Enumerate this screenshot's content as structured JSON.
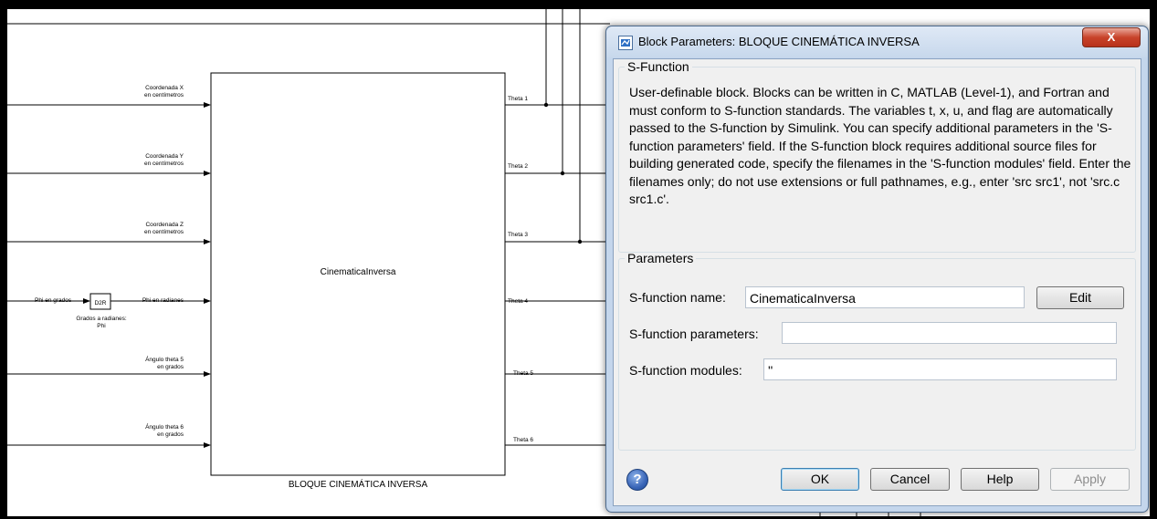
{
  "diagram": {
    "block_name": "CinematicaInversa",
    "block_caption": "BLOQUE CINEMÁTICA INVERSA",
    "inputs": [
      {
        "line1": "Coordenada X",
        "line2": "en centímetros"
      },
      {
        "line1": "Coordenada Y",
        "line2": "en centímetros"
      },
      {
        "line1": "Coordenada Z",
        "line2": "en centímetros"
      },
      {
        "line1": "Phi en radianes",
        "line2": ""
      },
      {
        "line1": "Ángulo theta 5",
        "line2": "en grados"
      },
      {
        "line1": "Ángulo theta 6",
        "line2": "en grados"
      }
    ],
    "outputs": [
      "Theta 1",
      "Theta 2",
      "Theta 3",
      "Theta 4",
      "Theta 5",
      "Theta 6"
    ],
    "phi_input_label": "Phi en grados",
    "d2r_block": {
      "text": "D2R",
      "caption_line1": "Grados a radianes:",
      "caption_line2": "Phi"
    }
  },
  "dialog": {
    "title": "Block Parameters: BLOQUE CINEMÁTICA INVERSA",
    "close_glyph": "X",
    "sfunction_group": {
      "legend": "S-Function",
      "description": "User-definable block.  Blocks can be written in C, MATLAB (Level-1), and Fortran and must conform to S-function standards.  The variables t, x, u, and flag are automatically passed to the S-function by Simulink.  You can specify additional parameters in the 'S-function parameters' field. If the S-function block requires additional source files for building generated code, specify the filenames in the 'S-function modules' field. Enter the filenames only; do not use extensions or full pathnames, e.g., enter 'src src1', not 'src.c src1.c'."
    },
    "parameters_group": {
      "legend": "Parameters",
      "name_label": "S-function name:",
      "name_value": "CinematicaInversa",
      "edit_label": "Edit",
      "params_label": "S-function parameters:",
      "params_value": "",
      "modules_label": "S-function modules:",
      "modules_value": "''"
    },
    "buttons": {
      "ok": "OK",
      "cancel": "Cancel",
      "help": "Help",
      "apply": "Apply"
    },
    "help_icon_glyph": "?"
  }
}
